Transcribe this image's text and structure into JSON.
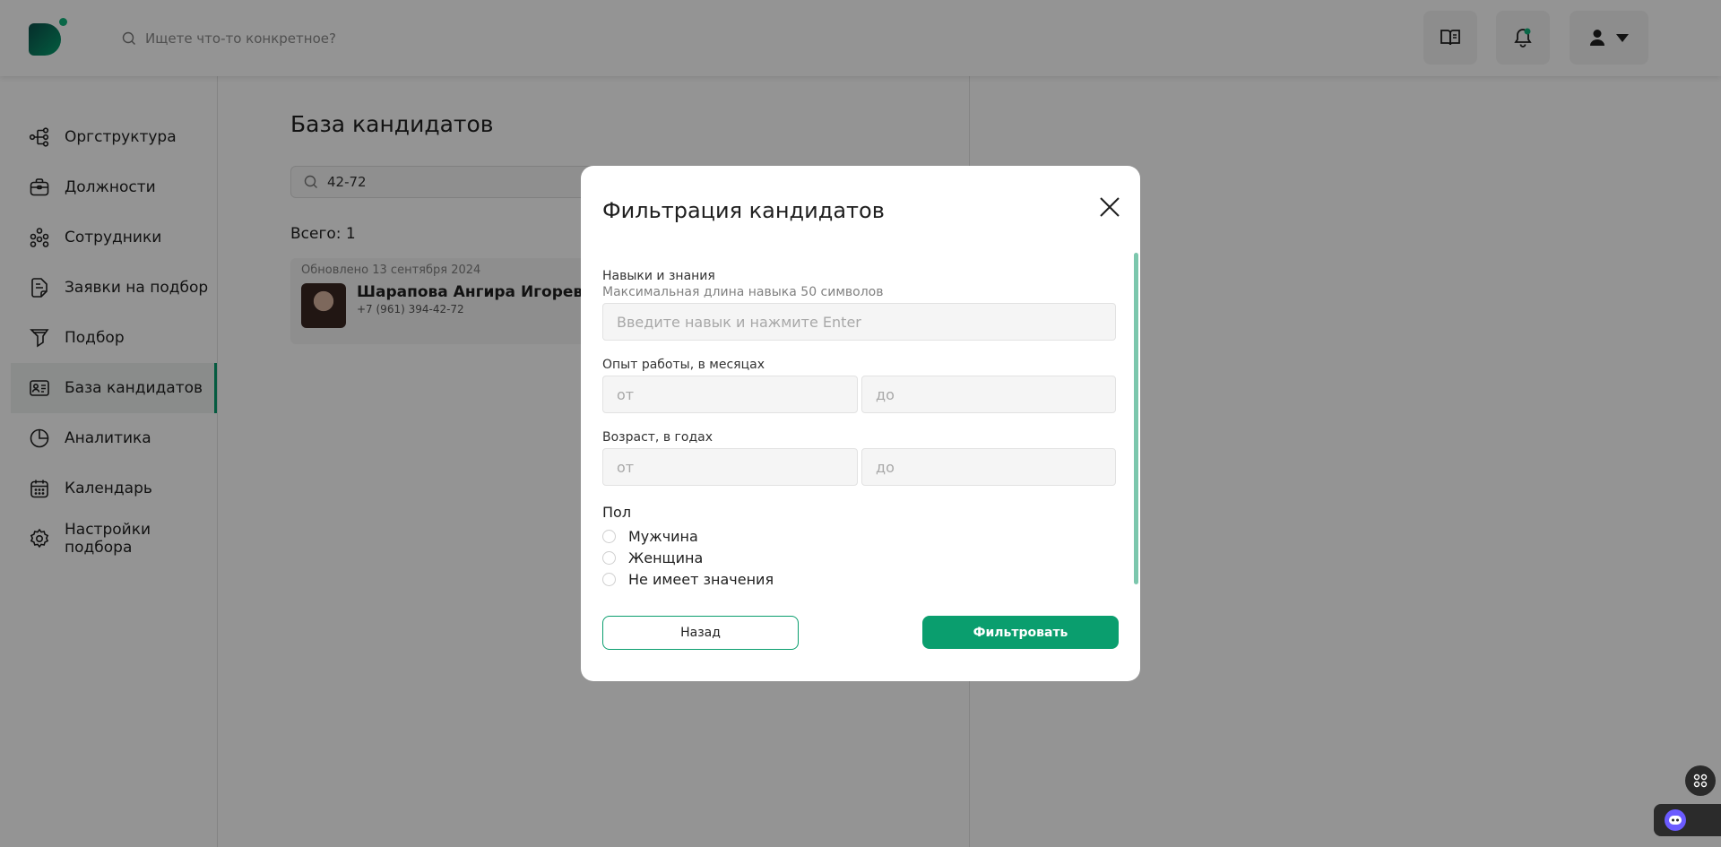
{
  "header": {
    "search_placeholder": "Ищете что-то конкретное?",
    "icons": [
      "book-icon",
      "bell-icon",
      "user-icon",
      "caret-down-icon"
    ]
  },
  "sidebar": {
    "items": [
      {
        "label": "Оргструктура",
        "icon": "org-structure-icon"
      },
      {
        "label": "Должности",
        "icon": "briefcase-icon"
      },
      {
        "label": "Сотрудники",
        "icon": "people-icon"
      },
      {
        "label": "Заявки на подбор",
        "icon": "document-icon"
      },
      {
        "label": "Подбор",
        "icon": "funnel-icon"
      },
      {
        "label": "База кандидатов",
        "icon": "id-card-icon",
        "active": true
      },
      {
        "label": "Аналитика",
        "icon": "pie-chart-icon"
      },
      {
        "label": "Календарь",
        "icon": "calendar-icon"
      },
      {
        "label": "Настройки подбора",
        "icon": "gear-icon"
      }
    ]
  },
  "main": {
    "title": "База кандидатов",
    "search_value": "42-72",
    "total": "Всего: 1",
    "candidate": {
      "updated": "Обновлено 13 сентября 2024",
      "name": "Шарапова Ангира Игоревна",
      "phone": "+7 (961) 394-42-72"
    }
  },
  "modal": {
    "title": "Фильтрация кандидатов",
    "skills": {
      "label": "Навыки и знания",
      "hint": "Максимальная длина навыка 50 символов",
      "placeholder": "Введите навык и нажмите Enter"
    },
    "experience": {
      "label": "Опыт работы, в месяцах",
      "from_placeholder": "от",
      "to_placeholder": "до"
    },
    "age": {
      "label": "Возраст, в годах",
      "from_placeholder": "от",
      "to_placeholder": "до"
    },
    "gender": {
      "title": "Пол",
      "options": [
        "Мужчина",
        "Женщина",
        "Не имеет значения"
      ]
    },
    "back_label": "Назад",
    "filter_label": "Фильтровать"
  },
  "colors": {
    "accent": "#0a9e6e",
    "overlay": "rgba(0,0,0,0.42)"
  }
}
